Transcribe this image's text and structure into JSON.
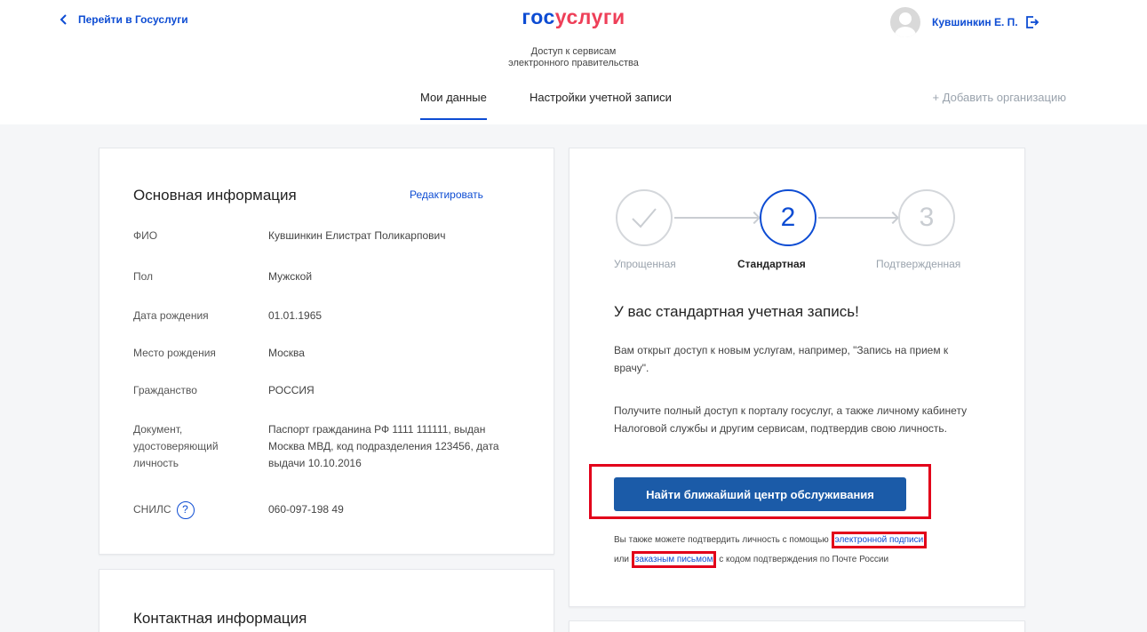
{
  "header": {
    "back_label": "Перейти в Госуслуги",
    "logo_part_1": "гос",
    "logo_part_2": "услуги",
    "logo_sub_1": "Доступ к сервисам",
    "logo_sub_2": "электронного правительства",
    "user_name": "Кувшинкин Е. П."
  },
  "tabs": {
    "my_data": "Мои данные",
    "settings": "Настройки учетной записи",
    "add_org": "+ Добавить организацию"
  },
  "info": {
    "title": "Основная информация",
    "edit_label": "Редактировать",
    "rows": [
      {
        "label": "ФИО",
        "value": "Кувшинкин Елистрат Поликарпович"
      },
      {
        "label": "Пол",
        "value": "Мужской"
      },
      {
        "label": "Дата рождения",
        "value": "01.01.1965"
      },
      {
        "label": "Место рождения",
        "value": "Москва"
      },
      {
        "label": "Гражданство",
        "value": "РОССИЯ"
      },
      {
        "label": "Документ, удостоверяющий личность",
        "value": "Паспорт гражданина РФ 1111 111111, выдан Москва МВД, код подразделения 123456, дата выдачи 10.10.2016"
      },
      {
        "label": "СНИЛС",
        "value": "060-097-198 49"
      }
    ],
    "help_mark": "?"
  },
  "contact": {
    "title": "Контактная информация"
  },
  "account": {
    "steps": [
      {
        "number": "",
        "label": "Упрощенная"
      },
      {
        "number": "2",
        "label": "Стандартная"
      },
      {
        "number": "3",
        "label": "Подтвержденная"
      }
    ],
    "active_step": 2,
    "title": "У вас стандартная учетная запись!",
    "text_1": "Вам открыт доступ к новым услугам, например, \"Запись на прием к врачу\".",
    "text_2": "Получите полный доступ к порталу госуслуг, а также личному кабинету Налоговой службы и другим сервисам, подтвердив свою личность.",
    "button_label": "Найти ближайший центр обслуживания",
    "small_prefix": "Вы также можете подтвердить личность с помощью",
    "small_link_1": "электронной подписи",
    "small_or": "или",
    "small_link_2": "заказным письмом",
    "small_suffix": "с кодом подтверждения по Почте России"
  },
  "colors": {
    "accent": "#0d4cd3",
    "brand_red": "#ee3f58",
    "highlight": "#e2001a",
    "button": "#1b5ba8"
  }
}
